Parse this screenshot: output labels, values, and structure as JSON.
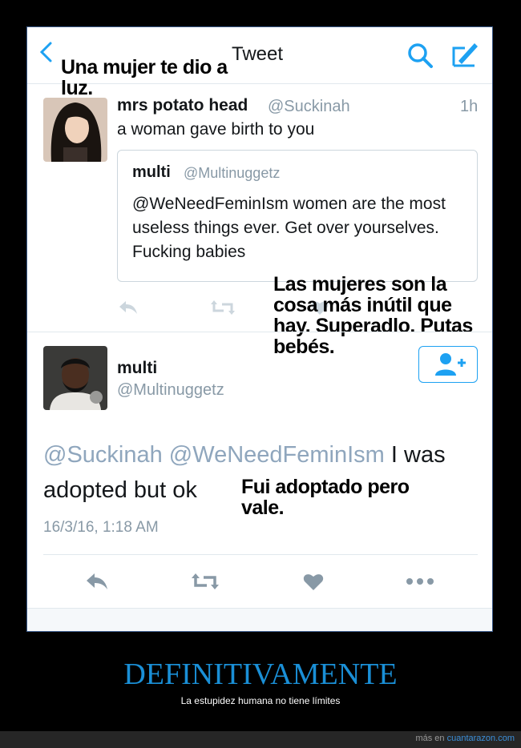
{
  "header": {
    "title": "Tweet"
  },
  "overlays": {
    "top": "Una mujer te dio a luz.",
    "middle": "Las mujeres son la cosa más inútil que hay. Superadlo. Putas bebés.",
    "bottom": "Fui adoptado pero vale."
  },
  "tweet1": {
    "name": "mrs potato head",
    "handle": "@Suckinah",
    "time": "1h",
    "text": "a woman gave birth to you",
    "quote": {
      "name": "multi",
      "handle": "@Multinuggetz",
      "text": "@WeNeedFeminIsm women are the most useless things ever. Get over yourselves. Fucking babies"
    }
  },
  "tweet2": {
    "name": "multi",
    "handle": "@Multinuggetz",
    "mentions": "@Suckinah @WeNeedFeminIsm",
    "text_line1_rest": " I was",
    "text_line2": "adopted but ok",
    "date": "16/3/16, 1:18 AM"
  },
  "caption": {
    "title": "DEFINITIVAMENTE",
    "subtitle": "La estupidez humana no tiene límites"
  },
  "footer": {
    "prefix": "más en ",
    "link": "cuantarazon.com"
  },
  "colors": {
    "twitter_blue": "#1da1f2",
    "caption_blue": "#1a8fd6",
    "background": "#000000"
  }
}
